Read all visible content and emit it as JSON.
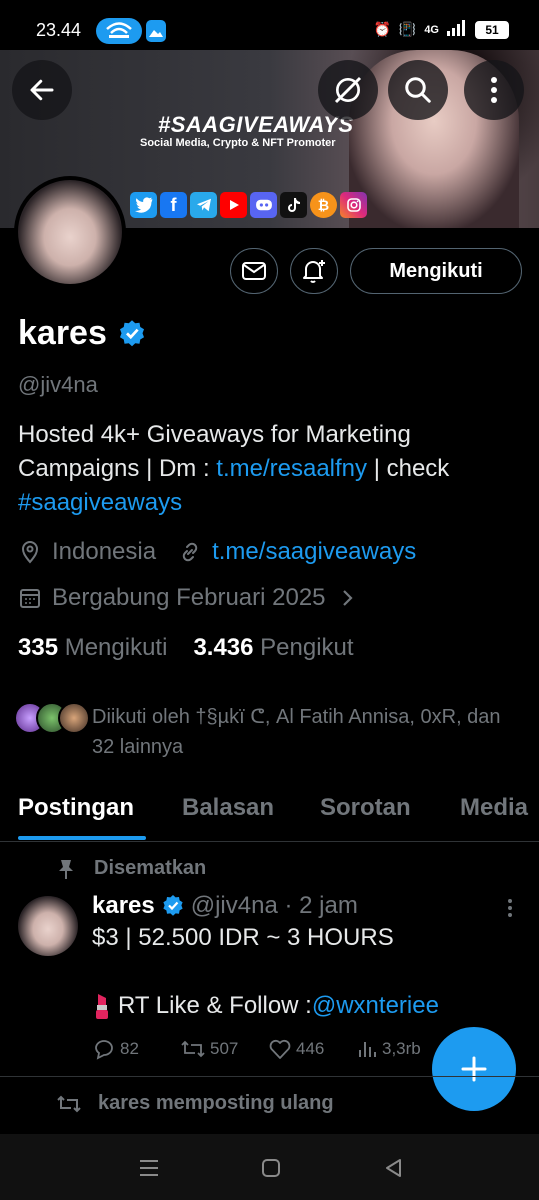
{
  "status_bar": {
    "time": "23.44",
    "network": "4G",
    "battery": "51"
  },
  "banner": {
    "title": "#SAAGIVEAWAYS",
    "subtitle": "Social Media, Crypto & NFT Promoter",
    "social_icons": [
      "twitter-icon",
      "facebook-icon",
      "telegram-icon",
      "youtube-icon",
      "discord-icon",
      "tiktok-icon",
      "bitcoin-icon",
      "instagram-icon"
    ]
  },
  "header": {
    "back_icon": "arrow-left-icon",
    "grok_icon": "slash-circle-icon",
    "search_icon": "search-icon",
    "more_icon": "more-vertical-icon"
  },
  "profile": {
    "name": "kares",
    "handle": "@jiv4na",
    "bio_text1": "Hosted 4k+ Giveaways for Marketing Campaigns | Dm : ",
    "bio_link1": "t.me/resaalfny",
    "bio_text2": " | check ",
    "bio_hashtag": "#saagiveaways",
    "location": "Indonesia",
    "website": "t.me/saagiveaways",
    "joined": "Bergabung Februari 2025",
    "following_count": "335",
    "following_label": "Mengikuti",
    "followers_count": "3.436",
    "followers_label": "Pengikut",
    "followed_by": "Diikuti oleh †§µkï ᕦ, Al Fatih Annisa, 0xR, dan 32 lainnya",
    "follow_button": "Mengikuti"
  },
  "tabs": [
    {
      "label": "Postingan",
      "active": true
    },
    {
      "label": "Balasan",
      "active": false
    },
    {
      "label": "Sorotan",
      "active": false
    },
    {
      "label": "Media",
      "active": false
    }
  ],
  "post": {
    "pinned_label": "Disematkan",
    "author": "kares",
    "handle_time": "@jiv4na · 2 jam",
    "line1": "$3 | 52.500 IDR ~ 3 HOURS",
    "line2_text": "RT Like & Follow : ",
    "line2_mention": "@wxnteriee",
    "replies": "82",
    "reposts": "507",
    "likes": "446",
    "views": "3,3rb"
  },
  "repost_note": "kares memposting ulang",
  "colors": {
    "accent": "#1d9bf0",
    "muted": "#71767b",
    "background": "#000000"
  }
}
